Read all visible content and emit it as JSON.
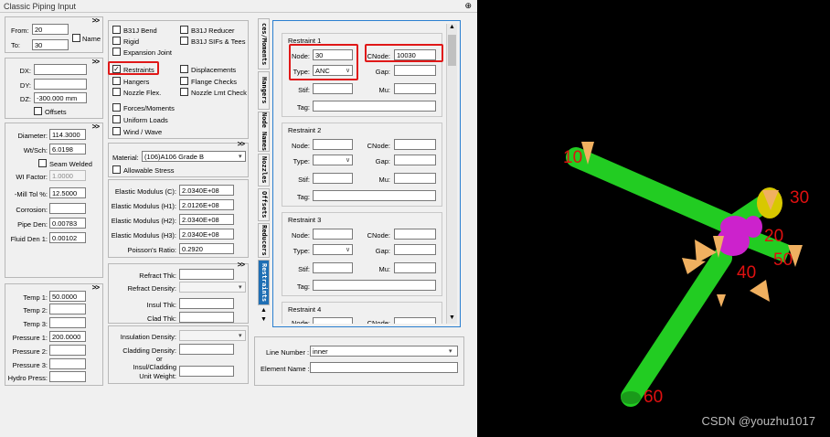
{
  "window": {
    "title": "Classic Piping Input",
    "pin_icon": "pin-icon"
  },
  "node_panel": {
    "from_label": "From:",
    "from_value": "20",
    "to_label": "To:",
    "to_value": "30",
    "name_label": "Name"
  },
  "delta_panel": {
    "dx_label": "DX:",
    "dx_value": "",
    "dy_label": "DY:",
    "dy_value": "",
    "dz_label": "DZ:",
    "dz_value": "-300.000 mm",
    "offsets_label": "Offsets"
  },
  "pipe_panel": {
    "diameter_label": "Diameter:",
    "diameter_value": "114.3000",
    "wt_label": "Wt/Sch:",
    "wt_value": "6.0198",
    "seam_label": "Seam Welded",
    "wi_label": "WI Factor:",
    "wi_value": "1.0000",
    "mill_label": "-Mill Tol %:",
    "mill_value": "12.5000",
    "corrosion_label": "Corrosion:",
    "corrosion_value": "",
    "pipe_den_label": "Pipe Den:",
    "pipe_den_value": "0.00783",
    "fluid_den_label": "Fluid Den 1:",
    "fluid_den_value": "0.00102"
  },
  "temp_panel": {
    "temp1_label": "Temp 1:",
    "temp1_value": "50.0000",
    "temp2_label": "Temp 2:",
    "temp3_label": "Temp 3:",
    "p1_label": "Pressure 1:",
    "p1_value": "200.0000",
    "p2_label": "Pressure 2:",
    "p3_label": "Pressure 3:",
    "hydro_label": "Hydro Press:"
  },
  "options": {
    "b31j_bend": "B31J Bend",
    "b31j_reducer": "B31J Reducer",
    "rigid": "Rigid",
    "b31j_sifs": "B31J SIFs & Tees",
    "expansion_joint": "Expansion Joint",
    "restraints": "Restraints",
    "displacements": "Displacements",
    "hangers": "Hangers",
    "flange_checks": "Flange Checks",
    "nozzle_flex": "Nozzle Flex.",
    "nozzle_lmt": "Nozzle Lmt Check",
    "forces": "Forces/Moments",
    "uniform_loads": "Uniform Loads",
    "wind_wave": "Wind / Wave"
  },
  "material": {
    "label": "Material:",
    "value": "(106)A106 Grade B",
    "allowable": "Allowable Stress"
  },
  "elastic": {
    "ec_label": "Elastic Modulus (C):",
    "ec_value": "2.0340E+08",
    "eh1_label": "Elastic Modulus (H1):",
    "eh1_value": "2.0126E+08",
    "eh2_label": "Elastic Modulus (H2):",
    "eh2_value": "2.0340E+08",
    "eh3_label": "Elastic Modulus (H3):",
    "eh3_value": "2.0340E+08",
    "poisson_label": "Poisson's Ratio:",
    "poisson_value": "0.2920"
  },
  "refract": {
    "thk_label": "Refract Thk:",
    "den_label": "Refract Density:",
    "insul_label": "Insul Thk:",
    "clad_label": "Clad Thk:"
  },
  "insulation": {
    "den_label": "Insulation Density:",
    "clad_den_label": "Cladding Density:",
    "or_label": "or",
    "unit_label_1": "Insul/Cladding",
    "unit_label_2": "Unit Weight:"
  },
  "tabs": [
    "ces/Moments",
    "Hangers",
    "Node Names",
    "Nozzles",
    "Offsets",
    "Reducers",
    "Restraints"
  ],
  "restraint_labels": {
    "node": "Node:",
    "cnode": "CNode:",
    "type": "Type:",
    "gap": "Gap:",
    "stif": "Stif:",
    "mu": "Mu:",
    "tag": "Tag:"
  },
  "restraints": [
    {
      "title": "Restraint 1",
      "node": "30",
      "cnode": "10030",
      "type": "ANC"
    },
    {
      "title": "Restraint 2",
      "node": "",
      "cnode": "",
      "type": ""
    },
    {
      "title": "Restraint 3",
      "node": "",
      "cnode": "",
      "type": ""
    },
    {
      "title": "Restraint 4"
    }
  ],
  "line_info": {
    "line_label": "Line Number :",
    "line_value": "inner",
    "element_label": "Element Name :",
    "element_value": ""
  },
  "viewport": {
    "labels": [
      "10",
      "30",
      "20",
      "50",
      "40",
      "60"
    ],
    "watermark": "CSDN @youzhu1017"
  },
  "colors": {
    "highlight": "#e01818",
    "pipe": "#22cc22",
    "node": "#cc22cc",
    "anchor": "#d8c800",
    "arrow": "#f0b060",
    "tab_active": "#1f6fb4",
    "label": "#e01010"
  }
}
